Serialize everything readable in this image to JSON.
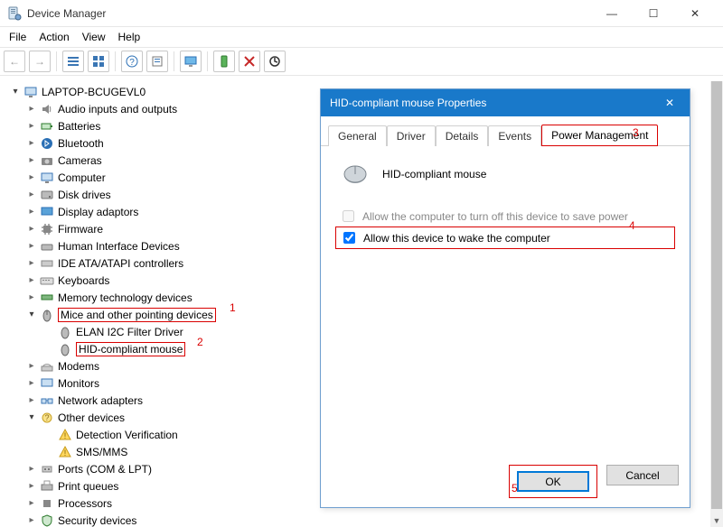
{
  "window": {
    "title": "Device Manager",
    "min": "—",
    "max": "☐",
    "close": "✕"
  },
  "menu": {
    "file": "File",
    "action": "Action",
    "view": "View",
    "help": "Help"
  },
  "arrows": {
    "left": "←",
    "right": "→"
  },
  "tree": {
    "root": "LAPTOP-BCUGEVL0",
    "items": [
      {
        "label": "Audio inputs and outputs"
      },
      {
        "label": "Batteries"
      },
      {
        "label": "Bluetooth"
      },
      {
        "label": "Cameras"
      },
      {
        "label": "Computer"
      },
      {
        "label": "Disk drives"
      },
      {
        "label": "Display adaptors"
      },
      {
        "label": "Firmware"
      },
      {
        "label": "Human Interface Devices"
      },
      {
        "label": "IDE ATA/ATAPI controllers"
      },
      {
        "label": "Keyboards"
      },
      {
        "label": "Memory technology devices"
      },
      {
        "label": "Mice and other pointing devices"
      },
      {
        "label": "Modems"
      },
      {
        "label": "Monitors"
      },
      {
        "label": "Network adapters"
      },
      {
        "label": "Other devices"
      },
      {
        "label": "Ports (COM & LPT)"
      },
      {
        "label": "Print queues"
      },
      {
        "label": "Processors"
      },
      {
        "label": "Security devices"
      }
    ],
    "mice_children": [
      {
        "label": "ELAN I2C Filter Driver"
      },
      {
        "label": "HID-compliant mouse"
      }
    ],
    "other_children": [
      {
        "label": "Detection Verification"
      },
      {
        "label": "SMS/MMS"
      }
    ]
  },
  "dialog": {
    "title": "HID-compliant mouse Properties",
    "tabs": {
      "general": "General",
      "driver": "Driver",
      "details": "Details",
      "events": "Events",
      "power": "Power Management"
    },
    "device_name": "HID-compliant mouse",
    "opt_turnoff": "Allow the computer to turn off this device to save power",
    "opt_wake": "Allow this device to wake the computer",
    "ok": "OK",
    "cancel": "Cancel"
  },
  "ann": {
    "a1": "1",
    "a2": "2",
    "a3": "3",
    "a4": "4",
    "a5": "5"
  }
}
